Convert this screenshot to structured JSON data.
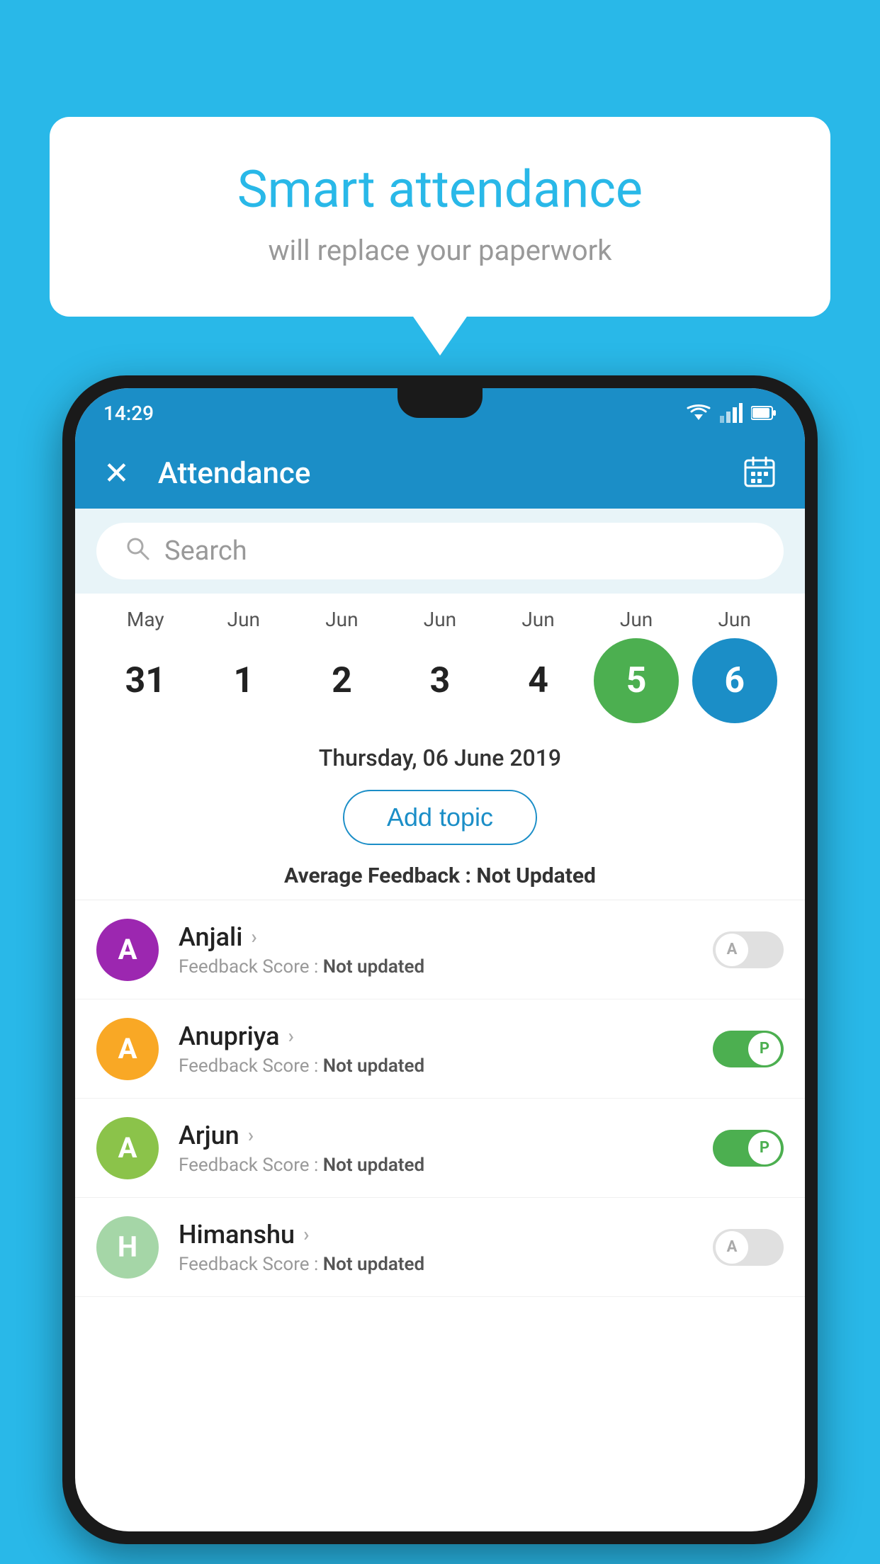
{
  "background_color": "#29b8e8",
  "bubble": {
    "title": "Smart attendance",
    "subtitle": "will replace your paperwork"
  },
  "status_bar": {
    "time": "14:29"
  },
  "app_bar": {
    "title": "Attendance",
    "close_label": "✕"
  },
  "search": {
    "placeholder": "Search"
  },
  "calendar": {
    "months": [
      "May",
      "Jun",
      "Jun",
      "Jun",
      "Jun",
      "Jun",
      "Jun"
    ],
    "dates": [
      "31",
      "1",
      "2",
      "3",
      "4",
      "5",
      "6"
    ],
    "today_index": 5,
    "selected_index": 6,
    "selected_date": "Thursday, 06 June 2019"
  },
  "add_topic": {
    "label": "Add topic"
  },
  "feedback_summary": {
    "label": "Average Feedback : ",
    "value": "Not Updated"
  },
  "students": [
    {
      "name": "Anjali",
      "avatar_letter": "A",
      "avatar_color": "#9c27b0",
      "feedback": "Feedback Score : ",
      "feedback_value": "Not updated",
      "toggle_state": "off",
      "toggle_label": "A"
    },
    {
      "name": "Anupriya",
      "avatar_letter": "A",
      "avatar_color": "#f9a825",
      "feedback": "Feedback Score : ",
      "feedback_value": "Not updated",
      "toggle_state": "on",
      "toggle_label": "P"
    },
    {
      "name": "Arjun",
      "avatar_letter": "A",
      "avatar_color": "#8bc34a",
      "feedback": "Feedback Score : ",
      "feedback_value": "Not updated",
      "toggle_state": "on",
      "toggle_label": "P"
    },
    {
      "name": "Himanshu",
      "avatar_letter": "H",
      "avatar_color": "#a5d6a7",
      "feedback": "Feedback Score : ",
      "feedback_value": "Not updated",
      "toggle_state": "off",
      "toggle_label": "A"
    }
  ]
}
